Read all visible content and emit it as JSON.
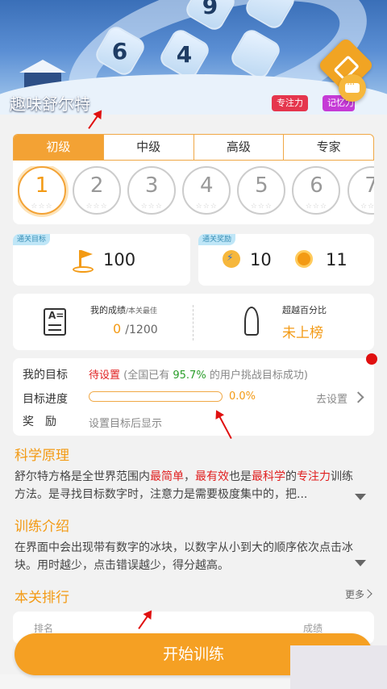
{
  "header": {
    "title": "趣味舒尔特",
    "tags": [
      "专注力",
      "记忆力"
    ],
    "tiles": [
      "6",
      "4",
      "9"
    ]
  },
  "level_tabs": [
    "初级",
    "中级",
    "高级",
    "专家"
  ],
  "active_tab": 0,
  "stages": [
    "1",
    "2",
    "3",
    "4",
    "5",
    "6",
    "7"
  ],
  "stars": "☆☆☆",
  "target": {
    "tag": "通关目标",
    "value": "100"
  },
  "reward": {
    "tag": "通关奖励",
    "energy": "10",
    "coins": "11"
  },
  "score": {
    "label_main": "我的成绩",
    "label_sub": "/本关最佳",
    "value": "0",
    "total": "/1200",
    "percentile_label": "超越百分比",
    "percentile_value": "未上榜"
  },
  "goal": {
    "label": "我的目标",
    "status": "待设置",
    "note_pre": "(全国已有 ",
    "note_pct": "95.7%",
    "note_post": " 的用户挑战目标成功)",
    "progress_label": "目标进度",
    "progress_pct": "0.0%",
    "progress_value": 0,
    "set_label": "去设置",
    "reward_label": "奖励",
    "reward_note": "设置目标后显示"
  },
  "science": {
    "title": "科学原理",
    "p1": "舒尔特方格是全世界范围内",
    "h1": "最简单",
    "p2": "，",
    "h2": "最有效",
    "p3": "也是",
    "h3": "最科学",
    "p4": "的",
    "h4": "专注力",
    "p5": "训练方法。是寻找目标数字时，注意力是需要极度集中的，把..."
  },
  "intro": {
    "title": "训练介绍",
    "text": "在界面中会出现带有数字的冰块，以数字从小到大的顺序依次点击冰块。用时越少，点击错误越少，得分越高。"
  },
  "ranking": {
    "title": "本关排行",
    "more": "更多",
    "col1": "排名",
    "col2": "成绩"
  },
  "start_button": "开始训练",
  "colors": {
    "accent": "#f3a234",
    "red": "#e02020",
    "green": "#2a9d2a"
  }
}
